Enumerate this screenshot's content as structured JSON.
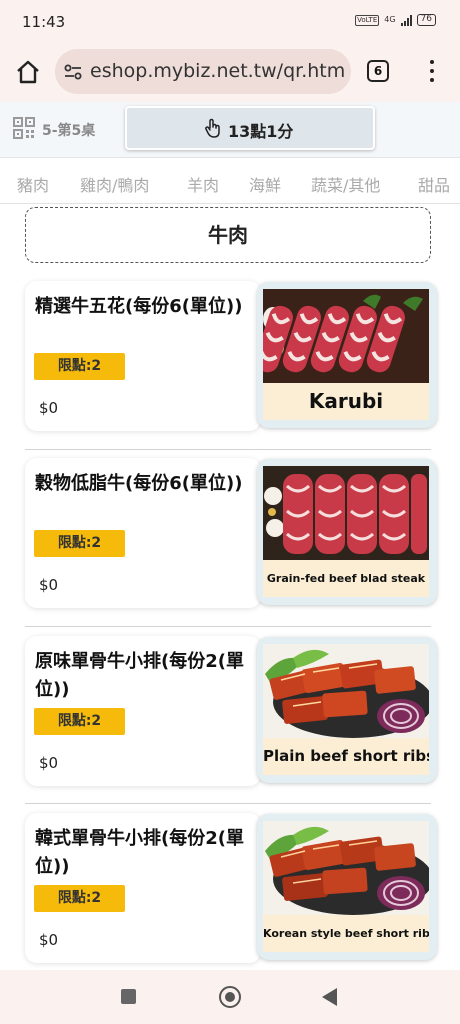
{
  "status_bar": {
    "time": "11:43",
    "network": "4G",
    "volte": "VoLTE",
    "battery": "76"
  },
  "browser": {
    "url": "eshop.mybiz.net.tw/qr.htm",
    "tab_count": "6"
  },
  "table_bar": {
    "table": "5-第5桌",
    "timer": "13點1分"
  },
  "categories": [
    "豬肉",
    "雞肉/鴨肉",
    "羊肉",
    "海鮮",
    "蔬菜/其他",
    "甜品"
  ],
  "section_title": "牛肉",
  "products": [
    {
      "name": "精選牛五花(每份6(單位))",
      "limit": "限點:2",
      "price": "$0",
      "image_caption": "Karubi",
      "image": "sliced-beef-rolls"
    },
    {
      "name": "穀物低脂牛(每份6(單位))",
      "limit": "限點:2",
      "price": "$0",
      "image_caption": "Grain-fed beef blad steak",
      "image": "sliced-beef-rolls"
    },
    {
      "name": "原味單骨牛小排(每份2(單位))",
      "limit": "限點:2",
      "price": "$0",
      "image_caption": "Plain beef short ribs",
      "image": "short-ribs-plate"
    },
    {
      "name": "韓式單骨牛小排(每份2(單位))",
      "limit": "限點:2",
      "price": "$0",
      "image_caption": "Korean style beef short ribs",
      "image": "short-ribs-plate"
    }
  ],
  "colors": {
    "accent": "#f6bb0a",
    "chrome": "#fbf1ee",
    "url_box": "#eeddd9",
    "caption_bg": "#fbeed4"
  }
}
